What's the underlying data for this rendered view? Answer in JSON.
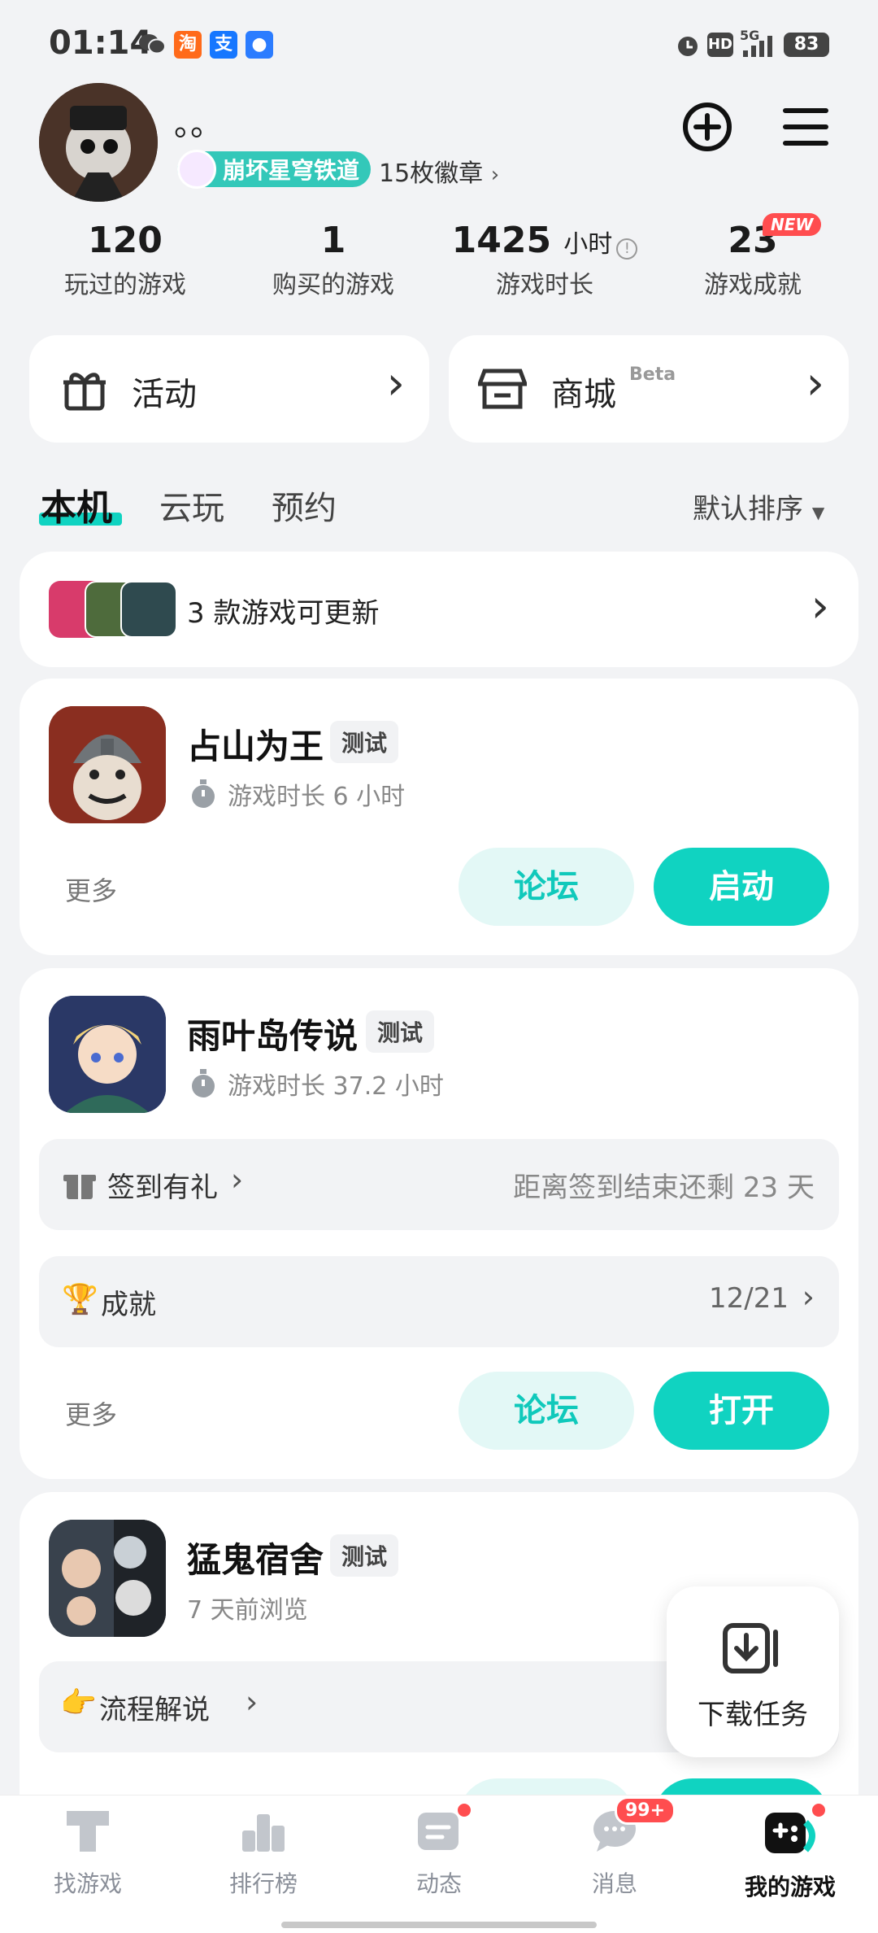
{
  "status_bar": {
    "time": "01:14",
    "battery": "83",
    "network": "5G",
    "hd": "HD"
  },
  "profile": {
    "name": "。。",
    "game_badge": "崩坏星穹铁道",
    "badges_count": "15枚徽章",
    "add_icon": "plus-circle-icon",
    "menu_icon": "hamburger-icon"
  },
  "stats": [
    {
      "value": "120",
      "label": "玩过的游戏"
    },
    {
      "value": "1",
      "label": "购买的游戏"
    },
    {
      "value": "1425",
      "unit": "小时",
      "label": "游戏时长"
    },
    {
      "value": "23",
      "label": "游戏成就",
      "badge": "NEW"
    }
  ],
  "shortcuts": {
    "activity": "活动",
    "store": "商城",
    "store_tag": "Beta"
  },
  "tabs": {
    "items": [
      "本机",
      "云玩",
      "预约"
    ],
    "active": "本机",
    "sort": "默认排序"
  },
  "update_banner": {
    "text": "3 款游戏可更新"
  },
  "games": [
    {
      "name": "占山为王",
      "tag": "测试",
      "meta": "游戏时长 6 小时",
      "more": "更多",
      "forum": "论坛",
      "action": "启动"
    },
    {
      "name": "雨叶岛传说",
      "tag": "测试",
      "meta": "游戏时长 37.2 小时",
      "signin": "签到有礼",
      "signin_note": "距离签到结束还剩 23 天",
      "achievement": "成就",
      "achievement_progress": "12/21",
      "more": "更多",
      "forum": "论坛",
      "action": "打开"
    },
    {
      "name": "猛鬼宿舍",
      "tag": "测试",
      "meta": "7 天前浏览",
      "guide": "流程解说"
    }
  ],
  "float_button": {
    "label": "下载任务"
  },
  "bottom_nav": [
    {
      "label": "找游戏",
      "icon": "t-icon"
    },
    {
      "label": "排行榜",
      "icon": "podium-icon"
    },
    {
      "label": "动态",
      "icon": "feed-icon"
    },
    {
      "label": "消息",
      "icon": "chat-icon",
      "badge": "99+"
    },
    {
      "label": "我的游戏",
      "icon": "gamepad-icon"
    }
  ],
  "colors": {
    "accent": "#10d3c1",
    "accent_light": "#e3f8f6",
    "badge_red": "#ff4d4f"
  }
}
